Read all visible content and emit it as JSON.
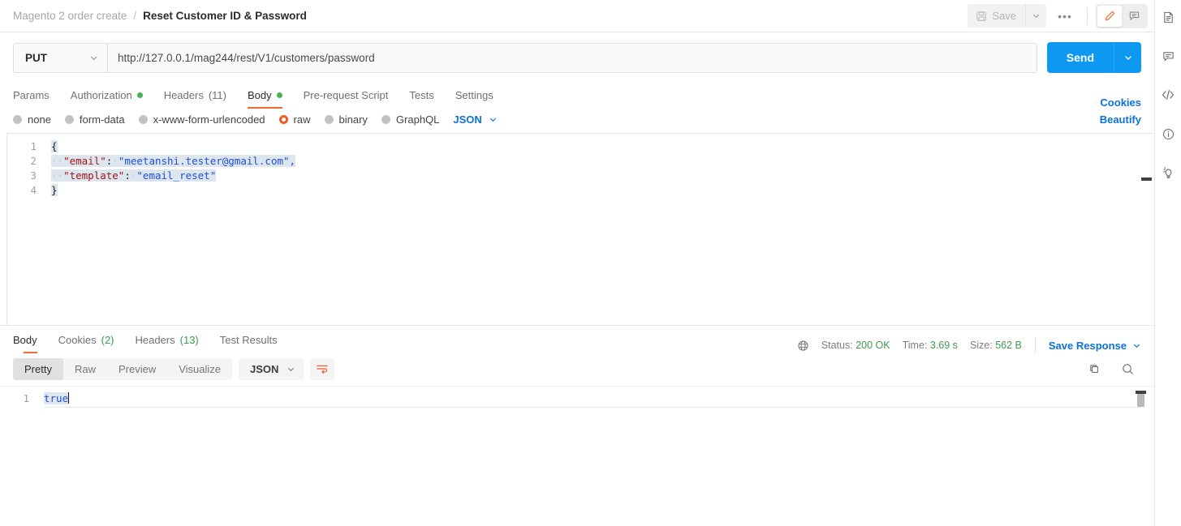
{
  "header": {
    "collection": "Magento 2 order create",
    "separator": "/",
    "request_name": "Reset Customer ID & Password",
    "save_label": "Save",
    "more_label": "•••",
    "icons": {
      "save": "floppy-disk-icon",
      "caret": "chevron-down-icon",
      "edit": "pencil-icon",
      "comment": "comment-icon"
    }
  },
  "request": {
    "method": "PUT",
    "url": "http://127.0.0.1/mag244/rest/V1/customers/password",
    "send_label": "Send"
  },
  "request_tabs": [
    {
      "label": "Params",
      "active": false,
      "dot": false,
      "count": ""
    },
    {
      "label": "Authorization",
      "active": false,
      "dot": true,
      "count": ""
    },
    {
      "label": "Headers",
      "active": false,
      "dot": false,
      "count": "(11)"
    },
    {
      "label": "Body",
      "active": true,
      "dot": true,
      "count": ""
    },
    {
      "label": "Pre-request Script",
      "active": false,
      "dot": false,
      "count": ""
    },
    {
      "label": "Tests",
      "active": false,
      "dot": false,
      "count": ""
    },
    {
      "label": "Settings",
      "active": false,
      "dot": false,
      "count": ""
    }
  ],
  "cookies_link": "Cookies",
  "beautify_link": "Beautify",
  "body_types": [
    {
      "label": "none",
      "selected": false
    },
    {
      "label": "form-data",
      "selected": false
    },
    {
      "label": "x-www-form-urlencoded",
      "selected": false
    },
    {
      "label": "raw",
      "selected": true
    },
    {
      "label": "binary",
      "selected": false
    },
    {
      "label": "GraphQL",
      "selected": false
    }
  ],
  "body_format": "JSON",
  "request_body": {
    "lines": [
      "1",
      "2",
      "3",
      "4"
    ],
    "line1": "{",
    "line2_key": "\"email\"",
    "line2_colon": ":",
    "line2_val": "\"meetanshi.tester@gmail.com\",",
    "line3_key": "\"template\"",
    "line3_colon": ":",
    "line3_val": "\"email_reset\"",
    "line4": "}",
    "indent_dots": "··"
  },
  "response_tabs": [
    {
      "label": "Body",
      "count": "",
      "active": true
    },
    {
      "label": "Cookies",
      "count": "(2)",
      "active": false
    },
    {
      "label": "Headers",
      "count": "(13)",
      "active": false
    },
    {
      "label": "Test Results",
      "count": "",
      "active": false
    }
  ],
  "response_meta": {
    "status_label": "Status:",
    "status_value": "200 OK",
    "time_label": "Time:",
    "time_value": "3.69 s",
    "size_label": "Size:",
    "size_value": "562 B",
    "save_response": "Save Response",
    "globe_icon": "globe-icon"
  },
  "response_toolbar": {
    "views": [
      {
        "label": "Pretty",
        "active": true
      },
      {
        "label": "Raw",
        "active": false
      },
      {
        "label": "Preview",
        "active": false
      },
      {
        "label": "Visualize",
        "active": false
      }
    ],
    "format": "JSON",
    "wrap_icon": "word-wrap-icon",
    "copy_icon": "copy-icon",
    "search_icon": "search-icon"
  },
  "response_body": {
    "line_number": "1",
    "value": "true"
  },
  "rail_icons": [
    "document-icon",
    "comment-icon",
    "code-icon",
    "info-icon",
    "lightbulb-icon"
  ],
  "colors": {
    "accent_orange": "#ef5b25",
    "link_blue": "#0b72d9",
    "send_blue": "#0d99f2",
    "status_green": "#3d9a50",
    "dot_green": "#4caf50"
  }
}
